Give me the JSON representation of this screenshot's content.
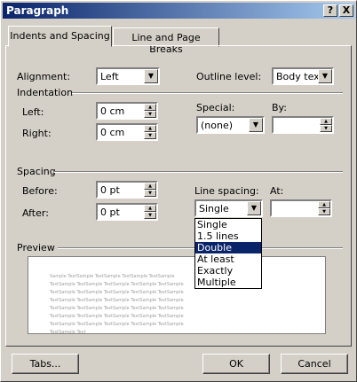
{
  "title": "Paragraph",
  "titlebar": {
    "help": "?",
    "close": "X"
  },
  "tabs": [
    {
      "label": "Indents and Spacing",
      "active": true
    },
    {
      "label": "Line and Page Breaks",
      "active": false
    }
  ],
  "general": {
    "alignment_label": "Alignment:",
    "alignment": "Left",
    "outline_label": "Outline level:",
    "outline": "Body text"
  },
  "indentation": {
    "heading": "Indentation",
    "left_label": "Left:",
    "left": "0 cm",
    "right_label": "Right:",
    "right": "0 cm",
    "special_label": "Special:",
    "special": "(none)",
    "by_label": "By:",
    "by": ""
  },
  "spacing": {
    "heading": "Spacing",
    "before_label": "Before:",
    "before": "0 pt",
    "after_label": "After:",
    "after": "0 pt",
    "line_spacing_label": "Line spacing:",
    "line_spacing": "Single",
    "at_label": "At:",
    "at": ""
  },
  "line_spacing_options": [
    "Single",
    "1.5 lines",
    "Double",
    "At least",
    "Exactly",
    "Multiple"
  ],
  "line_spacing_highlighted": "Double",
  "preview": {
    "heading": "Preview",
    "sample_text": "Sample TextSample TextSample TextSample TextSample TextSample TextSample TextSample TextSample TextSample TextSample TextSample TextSample TextSample TextSample TextSample TextSample TextSample TextSample TextSample TextSample TextSample TextSample TextSample TextSample TextSample TextSample TextSample TextSample TextSample TextSample TextSample TextSample TextSample TextSample TextSample Text"
  },
  "buttons": {
    "tabs": "Tabs...",
    "ok": "OK",
    "cancel": "Cancel"
  },
  "colors": {
    "titlebar_start": "#0a246a",
    "titlebar_end": "#a6caf0",
    "face": "#d4d0c8",
    "highlight": "#0a246a"
  }
}
